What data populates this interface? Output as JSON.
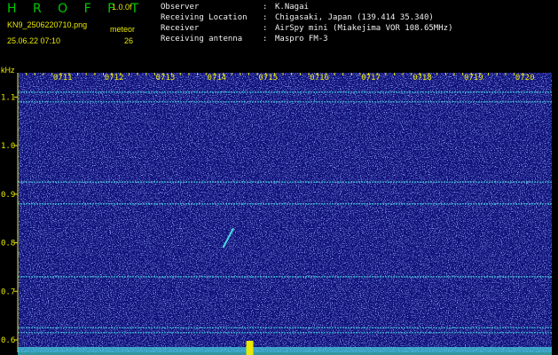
{
  "header": {
    "logo": "H R O F F T",
    "version": "1.0.0f",
    "filename": "KN9_2506220710.png",
    "timestamp": "25.06.22 07:10",
    "meteor_label": "meteor",
    "meteor_count": "26"
  },
  "info": [
    {
      "key": "Observer",
      "value": "K.Nagai"
    },
    {
      "key": "Receiving Location",
      "value": "Chigasaki, Japan (139.414 35.340)"
    },
    {
      "key": "Receiver",
      "value": "AirSpy mini (Miakejima VOR 108.65MHz)"
    },
    {
      "key": "Receiving antenna",
      "value": "Maspro FM-3"
    }
  ],
  "colors": {
    "background": "#000000",
    "spectrogram": "#10127a",
    "noise": "#3a4fd0",
    "line": "#49d9e0",
    "text_yellow": "#e8e800",
    "text_green": "#00c800",
    "text_white": "#f0f0f0"
  },
  "chart_data": {
    "type": "heatmap",
    "ylabel": "kHz",
    "ylim": [
      0.6,
      1.15
    ],
    "y_ticks": [
      {
        "value": 0.6,
        "label": "0.6"
      },
      {
        "value": 0.7,
        "label": "0.7"
      },
      {
        "value": 0.8,
        "label": "0.8"
      },
      {
        "value": 0.9,
        "label": "0.9"
      },
      {
        "value": 1.0,
        "label": "1.0"
      },
      {
        "value": 1.1,
        "label": "1.1"
      }
    ],
    "x_ticks": [
      "0711",
      "0712",
      "0713",
      "0714",
      "0715",
      "0716",
      "0717",
      "0718",
      "0719",
      "0720"
    ],
    "xlim_minutes": [
      0,
      10.4
    ],
    "carrier_lines_khz": [
      1.11,
      1.09,
      0.925,
      0.88,
      0.73,
      0.625,
      0.615
    ],
    "meteor_echo": {
      "x_minute_start": 4.0,
      "x_minute_end": 4.2,
      "khz_start": 0.79,
      "khz_end": 0.83
    }
  }
}
